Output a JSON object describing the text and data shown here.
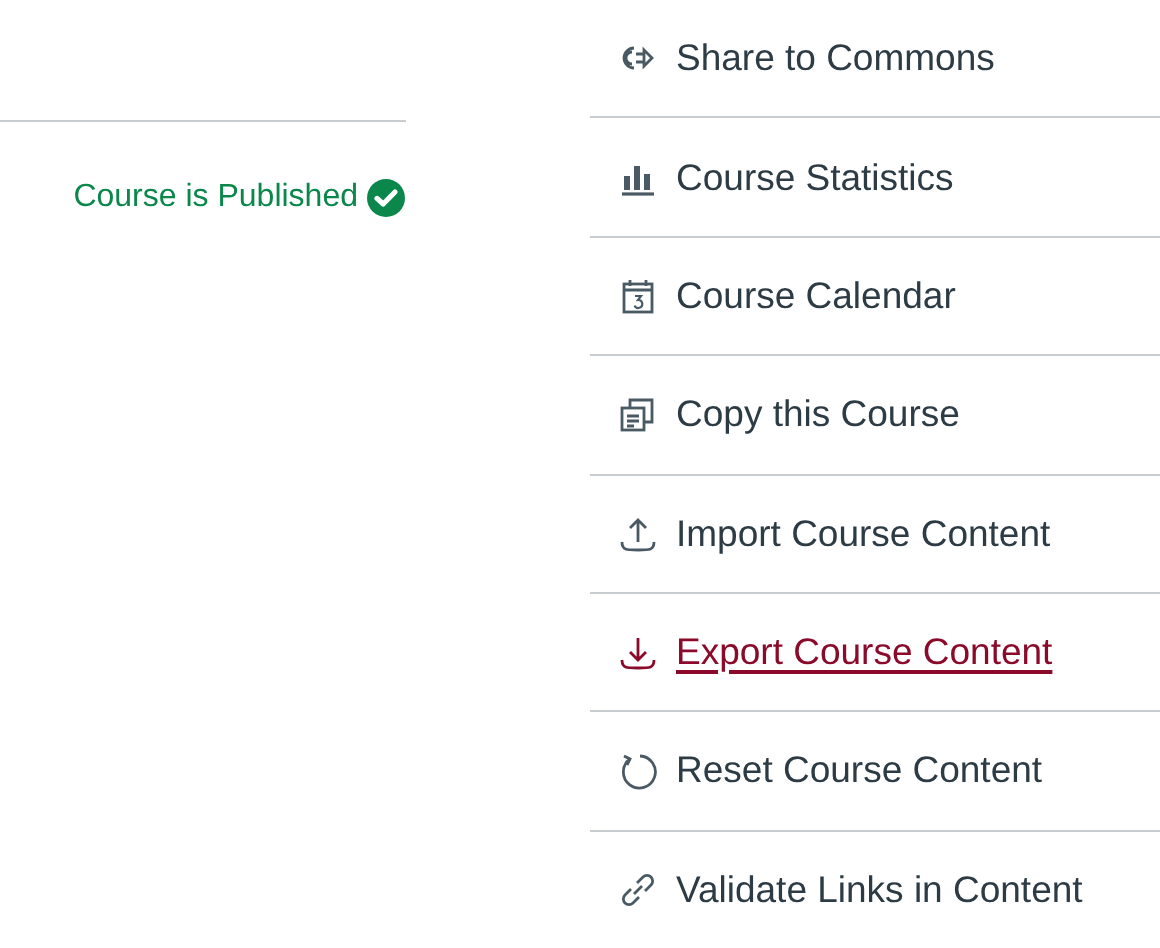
{
  "status": {
    "label": "Course is Published",
    "published": true
  },
  "menu": [
    {
      "label": "Share to Commons",
      "kind": "share",
      "selected": false
    },
    {
      "label": "Course Statistics",
      "kind": "stats",
      "selected": false
    },
    {
      "label": "Course Calendar",
      "kind": "calendar",
      "selected": false
    },
    {
      "label": "Copy this Course",
      "kind": "copy",
      "selected": false
    },
    {
      "label": "Import Course Content",
      "kind": "import",
      "selected": false
    },
    {
      "label": "Export Course Content",
      "kind": "export",
      "selected": true
    },
    {
      "label": "Reset Course Content",
      "kind": "reset",
      "selected": false
    },
    {
      "label": "Validate Links in Content",
      "kind": "link",
      "selected": false
    }
  ]
}
